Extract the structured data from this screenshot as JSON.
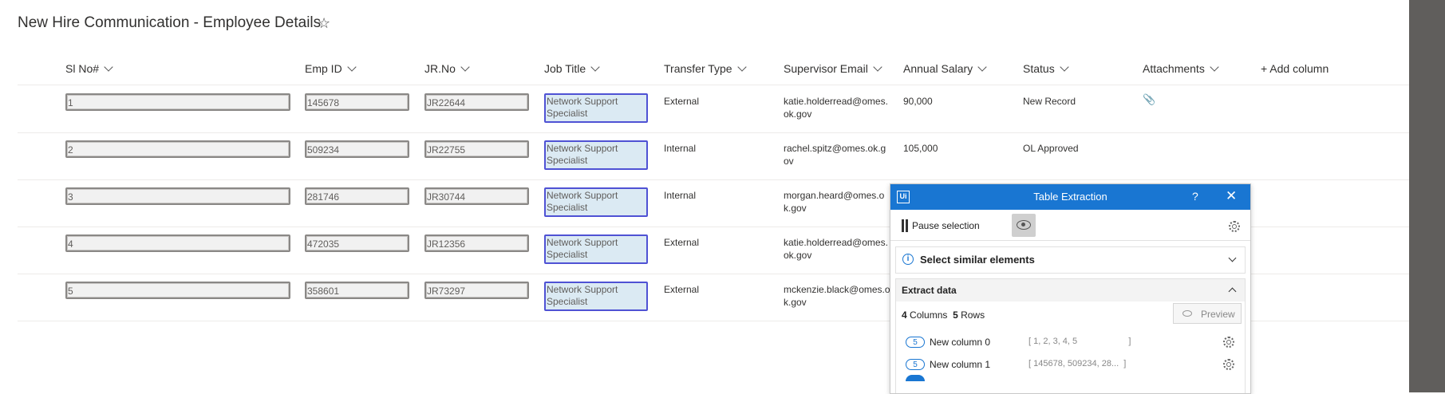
{
  "page": {
    "title": "New Hire Communication - Employee Details",
    "favorite_icon": "star-icon"
  },
  "columns": [
    {
      "label": "Sl No#"
    },
    {
      "label": "Emp ID"
    },
    {
      "label": "JR.No"
    },
    {
      "label": "Job Title"
    },
    {
      "label": "Transfer Type"
    },
    {
      "label": "Supervisor Email"
    },
    {
      "label": "Annual Salary"
    },
    {
      "label": "Status"
    },
    {
      "label": "Attachments"
    }
  ],
  "add_column_label": "+ Add column",
  "rows": [
    {
      "sl": "1",
      "emp_id": "145678",
      "jr": "JR22644",
      "job_l1": "Network Support",
      "job_l2": "Specialist",
      "transfer": "External",
      "email_l1": "katie.holderread@omes.",
      "email_l2": "ok.gov",
      "salary": "90,000",
      "status": "New Record",
      "attachment": true
    },
    {
      "sl": "2",
      "emp_id": "509234",
      "jr": "JR22755",
      "job_l1": "Network Support",
      "job_l2": "Specialist",
      "transfer": "Internal",
      "email_l1": "rachel.spitz@omes.ok.g",
      "email_l2": "ov",
      "salary": "105,000",
      "status": "OL Approved",
      "attachment": false
    },
    {
      "sl": "3",
      "emp_id": "281746",
      "jr": "JR30744",
      "job_l1": "Network Support",
      "job_l2": "Specialist",
      "transfer": "Internal",
      "email_l1": "morgan.heard@omes.o",
      "email_l2": "k.gov",
      "salary": "",
      "status": "",
      "attachment": false
    },
    {
      "sl": "4",
      "emp_id": "472035",
      "jr": "JR12356",
      "job_l1": "Network Support",
      "job_l2": "Specialist",
      "transfer": "External",
      "email_l1": "katie.holderread@omes.",
      "email_l2": "ok.gov",
      "salary": "",
      "status": "",
      "attachment": false
    },
    {
      "sl": "5",
      "emp_id": "358601",
      "jr": "JR73297",
      "job_l1": "Network Support",
      "job_l2": "Specialist",
      "transfer": "External",
      "email_l1": "mckenzie.black@omes.o",
      "email_l2": "k.gov",
      "salary": "",
      "status": "",
      "attachment": false
    }
  ],
  "panel": {
    "logo": "Ui",
    "title": "Table Extraction",
    "help": "?",
    "close": "✕",
    "pause_label": "Pause selection",
    "select_similar": "Select similar elements",
    "extract_data": "Extract data",
    "columns_count": "4",
    "columns_word": "Columns",
    "rows_count": "5",
    "rows_word": "Rows",
    "preview_label": "Preview",
    "extracted_columns": [
      {
        "count": "5",
        "name": "New column 0",
        "values": "[ 1, 2, 3, 4, 5                     ]"
      },
      {
        "count": "5",
        "name": "New column 1",
        "values": "[ 145678, 509234, 28...  ]"
      }
    ],
    "accent_color": "#1976d2"
  },
  "colors": {
    "job_title_highlight_border": "#4f52d4",
    "job_title_highlight_fill": "#dbeaf3",
    "right_strip": "#605e5c"
  }
}
